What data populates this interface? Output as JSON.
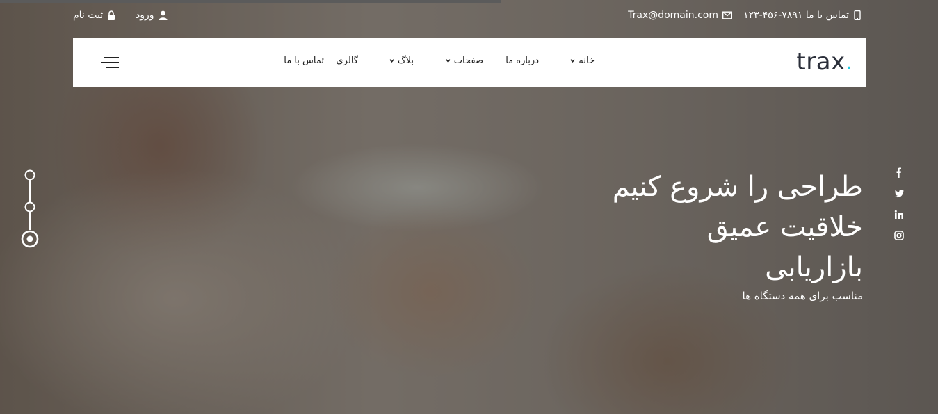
{
  "topbar": {
    "phone": "تماس با ما ۷۸۹۱-۴۵۶-۱۲۳",
    "email": "Trax@domain.com",
    "login": "ورود",
    "register": "ثبت نام"
  },
  "brand": {
    "name": "trax",
    "dot": ".",
    "accent": "#1ecbe1"
  },
  "nav": {
    "items": [
      {
        "label": "خانه",
        "has_dropdown": true
      },
      {
        "label": "درباره ما",
        "has_dropdown": false
      },
      {
        "label": "صفحات",
        "has_dropdown": true
      },
      {
        "label": "بلاگ",
        "has_dropdown": true
      },
      {
        "label": "گالری",
        "has_dropdown": false
      },
      {
        "label": "تماس با ما",
        "has_dropdown": false
      }
    ]
  },
  "hero": {
    "lines": [
      "طراحی را شروع کنیم",
      "خلاقیت عمیق",
      "بازاریابی"
    ],
    "subtitle": "مناسب برای همه دستگاه ها"
  },
  "social": {
    "icons": [
      "facebook-icon",
      "twitter-icon",
      "linkedin-icon",
      "instagram-icon"
    ]
  },
  "slider": {
    "count": 3,
    "active_index": 2
  }
}
